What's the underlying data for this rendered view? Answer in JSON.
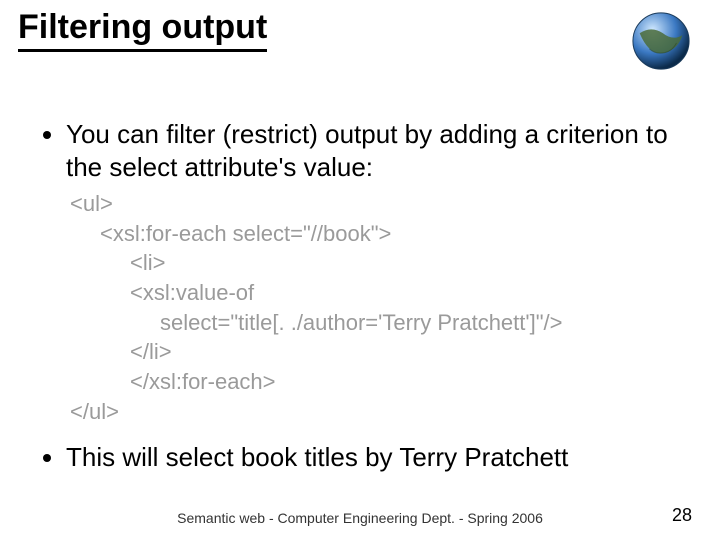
{
  "title": "Filtering output",
  "bullets": {
    "b1": "You can filter (restrict) output by adding a criterion to the select attribute's value:",
    "b2": "This will select book titles by Terry Pratchett"
  },
  "code": {
    "l1": "<ul>",
    "l2": "<xsl:for-each select=\"//book\">",
    "l3": "<li>",
    "l4": "<xsl:value-of",
    "l5": "select=\"title[. ./author='Terry Pratchett']\"/>",
    "l6": "</li>",
    "l7": "</xsl:for-each>",
    "l8": "</ul>"
  },
  "footer": "Semantic web - Computer Engineering Dept. - Spring 2006",
  "page": "28",
  "icons": {
    "globe": "globe-icon"
  }
}
